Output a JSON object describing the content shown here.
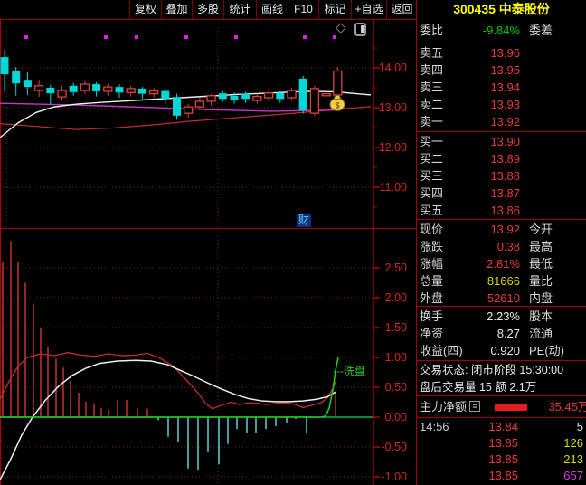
{
  "toolbar": {
    "items": [
      "复权",
      "叠加",
      "多股",
      "统计",
      "画线",
      "F10",
      "标记",
      "+自选",
      "返回"
    ]
  },
  "stock": {
    "title": "300435 中泰股份"
  },
  "order_book": {
    "weibi_label": "委比",
    "weibi_value": "-9.84%",
    "weicha_label": "委差",
    "asks": [
      {
        "label": "卖五",
        "price": "13.96"
      },
      {
        "label": "卖四",
        "price": "13.95"
      },
      {
        "label": "卖三",
        "price": "13.94"
      },
      {
        "label": "卖二",
        "price": "13.93"
      },
      {
        "label": "卖一",
        "price": "13.92"
      }
    ],
    "bids": [
      {
        "label": "买一",
        "price": "13.90"
      },
      {
        "label": "买二",
        "price": "13.89"
      },
      {
        "label": "买三",
        "price": "13.88"
      },
      {
        "label": "买四",
        "price": "13.87"
      },
      {
        "label": "买五",
        "price": "13.86"
      }
    ]
  },
  "quote": {
    "rows": [
      {
        "label": "现价",
        "value": "13.92",
        "label2": "今开"
      },
      {
        "label": "涨跌",
        "value": "0.38",
        "label2": "最高"
      },
      {
        "label": "涨幅",
        "value": "2.81%",
        "label2": "最低"
      },
      {
        "label": "总量",
        "value": "81666",
        "label2": "量比"
      },
      {
        "label": "外盘",
        "value": "52610",
        "label2": "内盘"
      },
      {
        "label": "换手",
        "value": "2.23%",
        "label2": "股本"
      },
      {
        "label": "净资",
        "value": "8.27",
        "label2": "流通"
      },
      {
        "label": "收益(四)",
        "value": "0.920",
        "label2": "PE(动)"
      }
    ]
  },
  "status": {
    "line1": "交易状态: 闭市阶段 15:30:00",
    "line2": "盘后交易量 15 额 2.1万"
  },
  "main_net": {
    "label": "主力净额",
    "icon": "≡",
    "value": "35.45万"
  },
  "ticks": [
    {
      "time": "14:56",
      "price": "13.84",
      "vol": "5"
    },
    {
      "time": "",
      "price": "13.85",
      "vol": "126"
    },
    {
      "time": "",
      "price": "13.85",
      "vol": "213"
    },
    {
      "time": "",
      "price": "13.85",
      "vol": "657"
    }
  ],
  "annotations": {
    "cai": "财",
    "xipan": "---洗盘"
  },
  "icons": {
    "diamond": "◇",
    "panel_toggle": "panel-toggle",
    "money_bag": "$",
    "detail_list": "≡"
  },
  "colors": {
    "accent_red_border": "#a40000",
    "grid": "#7d1f1f",
    "axis": "#b00000",
    "axis_text": "#d22626",
    "candle_up": "#e04040",
    "candle_down": "#00d8d8",
    "ma_white": "#f0f0f0",
    "ma_magenta": "#c23ac2",
    "ma_red": "#c03030",
    "bar_pos": "#c23333",
    "bar_neg": "#58d4d4",
    "zero_line": "#00b854",
    "signal_green": "#1ecc1e",
    "dot_magenta": "#e020e0",
    "title_yellow": "#ffff00"
  },
  "chart_data": [
    {
      "type": "candlestick",
      "ylabels": [
        "14.00",
        "13.00",
        "12.00",
        "11.00"
      ],
      "ylim": [
        9.98,
        15.2
      ],
      "x_start": 5,
      "x_step": 12.7,
      "candles": [
        [
          14.27,
          14.45,
          13.4,
          13.84,
          1
        ],
        [
          13.93,
          14.02,
          13.3,
          13.61,
          1
        ],
        [
          13.7,
          13.89,
          13.32,
          13.52,
          1
        ],
        [
          13.43,
          13.7,
          13.27,
          13.55,
          0
        ],
        [
          13.5,
          13.57,
          13.09,
          13.36,
          1
        ],
        [
          13.27,
          13.55,
          13.2,
          13.43,
          0
        ],
        [
          13.55,
          13.62,
          13.3,
          13.39,
          1
        ],
        [
          13.43,
          13.68,
          13.35,
          13.59,
          0
        ],
        [
          13.59,
          13.64,
          13.28,
          13.41,
          1
        ],
        [
          13.41,
          13.6,
          13.3,
          13.52,
          0
        ],
        [
          13.52,
          13.58,
          13.25,
          13.38,
          1
        ],
        [
          13.38,
          13.55,
          13.28,
          13.48,
          0
        ],
        [
          13.48,
          13.52,
          13.22,
          13.35,
          1
        ],
        [
          13.35,
          13.5,
          13.25,
          13.42,
          0
        ],
        [
          13.42,
          13.46,
          13.1,
          13.22,
          1
        ],
        [
          13.27,
          13.35,
          12.7,
          12.8,
          1
        ],
        [
          12.86,
          13.1,
          12.75,
          13.02,
          0
        ],
        [
          13.02,
          13.25,
          12.95,
          13.16,
          0
        ],
        [
          13.16,
          13.35,
          13.05,
          13.3,
          0
        ],
        [
          13.36,
          13.42,
          13.15,
          13.22,
          1
        ],
        [
          13.3,
          13.38,
          13.1,
          13.18,
          1
        ],
        [
          13.35,
          13.4,
          13.12,
          13.22,
          1
        ],
        [
          13.18,
          13.35,
          13.1,
          13.28,
          0
        ],
        [
          13.25,
          13.48,
          13.15,
          13.37,
          0
        ],
        [
          13.37,
          13.42,
          13.12,
          13.22,
          1
        ],
        [
          13.25,
          13.5,
          13.18,
          13.43,
          0
        ],
        [
          13.73,
          13.8,
          12.85,
          12.93,
          1
        ],
        [
          12.86,
          13.55,
          12.8,
          13.48,
          0
        ],
        [
          13.3,
          13.45,
          13.15,
          13.35,
          0
        ],
        [
          13.32,
          14.02,
          13.2,
          13.92,
          0
        ]
      ],
      "ma_white": [
        [
          0,
          12.25
        ],
        [
          20,
          12.62
        ],
        [
          40,
          12.88
        ],
        [
          60,
          13.02
        ],
        [
          85,
          13.09
        ],
        [
          110,
          13.13
        ],
        [
          140,
          13.17
        ],
        [
          170,
          13.21
        ],
        [
          200,
          13.25
        ],
        [
          230,
          13.29
        ],
        [
          260,
          13.33
        ],
        [
          290,
          13.36
        ],
        [
          320,
          13.39
        ],
        [
          345,
          13.41
        ],
        [
          370,
          13.4
        ],
        [
          390,
          13.36
        ],
        [
          410,
          13.32
        ]
      ],
      "ma_red": [
        [
          0,
          12.6
        ],
        [
          40,
          12.53
        ],
        [
          85,
          12.45
        ],
        [
          125,
          12.49
        ],
        [
          165,
          12.56
        ],
        [
          205,
          12.65
        ],
        [
          245,
          12.72
        ],
        [
          285,
          12.79
        ],
        [
          325,
          12.86
        ],
        [
          365,
          12.94
        ],
        [
          410,
          13.03
        ]
      ],
      "ma_magenta": [
        [
          0,
          13.11
        ],
        [
          80,
          13.07
        ],
        [
          160,
          13.01
        ],
        [
          230,
          12.95
        ],
        [
          300,
          12.91
        ],
        [
          372,
          12.94
        ]
      ],
      "signal_dots_x": [
        29,
        117,
        151,
        206,
        261,
        337,
        370
      ],
      "grid_vlines_x": [
        7,
        241
      ],
      "money_bag": {
        "x": 373,
        "price": 13.15
      }
    },
    {
      "type": "bar",
      "ylabels": [
        "2.50",
        "2.00",
        "1.50",
        "1.00",
        "0.50",
        "0.00",
        "-0.50",
        "-1.00"
      ],
      "ylim": [
        -1.15,
        3.15
      ],
      "bars": [
        [
          3,
          2.6
        ],
        [
          12,
          2.95
        ],
        [
          20,
          2.6
        ],
        [
          28,
          2.25
        ],
        [
          37,
          1.9
        ],
        [
          45,
          1.5
        ],
        [
          53,
          1.18
        ],
        [
          62,
          0.98
        ],
        [
          70,
          0.83
        ],
        [
          78,
          0.6
        ],
        [
          87,
          0.41
        ],
        [
          95,
          0.26
        ],
        [
          104,
          0.23
        ],
        [
          112,
          0.15
        ],
        [
          120,
          0.12
        ],
        [
          130,
          0.29
        ],
        [
          140,
          0.29
        ],
        [
          152,
          0.15
        ],
        [
          163,
          0.14
        ],
        [
          175,
          -0.05
        ],
        [
          186,
          -0.33
        ],
        [
          197,
          -0.41
        ],
        [
          208,
          -0.86
        ],
        [
          219,
          -0.88
        ],
        [
          230,
          -0.58
        ],
        [
          242,
          -0.79
        ],
        [
          252,
          -0.45
        ],
        [
          262,
          -0.2
        ],
        [
          273,
          -0.27
        ],
        [
          283,
          -0.26
        ],
        [
          294,
          -0.2
        ],
        [
          305,
          -0.15
        ],
        [
          317,
          -0.09
        ],
        [
          327,
          -0.03
        ],
        [
          339,
          -0.27
        ],
        [
          371,
          0.42
        ]
      ],
      "line_white": [
        [
          0,
          -1.05
        ],
        [
          12,
          -0.7
        ],
        [
          24,
          -0.3
        ],
        [
          36,
          0.0
        ],
        [
          50,
          0.28
        ],
        [
          65,
          0.52
        ],
        [
          80,
          0.7
        ],
        [
          95,
          0.82
        ],
        [
          110,
          0.9
        ],
        [
          130,
          0.94
        ],
        [
          150,
          0.95
        ],
        [
          167,
          0.94
        ],
        [
          185,
          0.88
        ],
        [
          200,
          0.78
        ],
        [
          215,
          0.68
        ],
        [
          230,
          0.57
        ],
        [
          245,
          0.47
        ],
        [
          260,
          0.38
        ],
        [
          275,
          0.31
        ],
        [
          290,
          0.27
        ],
        [
          305,
          0.26
        ],
        [
          320,
          0.26
        ],
        [
          335,
          0.27
        ],
        [
          350,
          0.3
        ],
        [
          362,
          0.34
        ],
        [
          371,
          0.42
        ]
      ],
      "line_red": [
        [
          0,
          0.3
        ],
        [
          10,
          0.6
        ],
        [
          20,
          0.85
        ],
        [
          30,
          1.0
        ],
        [
          45,
          1.06
        ],
        [
          60,
          1.03
        ],
        [
          75,
          1.08
        ],
        [
          90,
          1.04
        ],
        [
          105,
          1.02
        ],
        [
          120,
          1.06
        ],
        [
          135,
          1.03
        ],
        [
          150,
          1.04
        ],
        [
          163,
          1.07
        ],
        [
          178,
          0.98
        ],
        [
          192,
          0.85
        ],
        [
          205,
          0.64
        ],
        [
          218,
          0.42
        ],
        [
          228,
          0.22
        ],
        [
          235,
          0.14
        ],
        [
          245,
          0.2
        ],
        [
          255,
          0.25
        ],
        [
          265,
          0.21
        ],
        [
          275,
          0.24
        ],
        [
          285,
          0.23
        ],
        [
          295,
          0.21
        ],
        [
          305,
          0.23
        ],
        [
          315,
          0.24
        ],
        [
          325,
          0.22
        ],
        [
          335,
          0.16
        ],
        [
          345,
          0.2
        ],
        [
          355,
          0.24
        ],
        [
          362,
          0.32
        ],
        [
          368,
          0.48
        ],
        [
          372,
          0.62
        ]
      ],
      "line_green": [
        [
          0,
          0
        ],
        [
          356,
          0
        ],
        [
          360,
          0.02
        ],
        [
          364,
          0.15
        ],
        [
          368,
          0.45
        ],
        [
          371,
          0.78
        ],
        [
          374,
          1.0
        ]
      ],
      "grid_vlines_x": [
        241
      ],
      "annotation_label": "---洗盘"
    }
  ]
}
